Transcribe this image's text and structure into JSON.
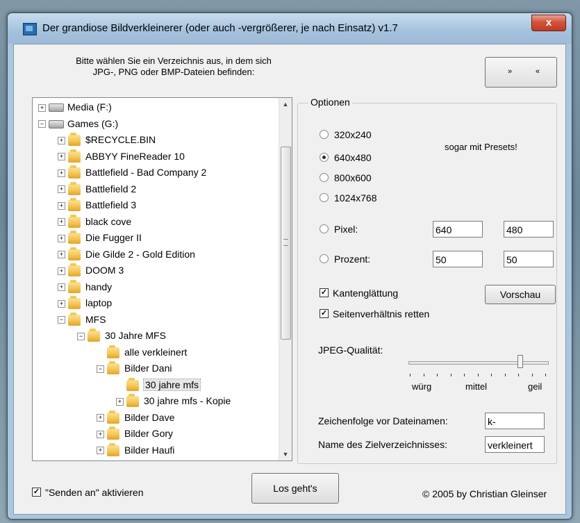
{
  "window": {
    "title": "Der grandiose Bildverkleinerer (oder auch -vergrößerer, je nach Einsatz) v1.7",
    "close_label": "x"
  },
  "intro": {
    "line1": "Bitte wählen Sie ein Verzeichnis aus, in dem sich",
    "line2": "JPG-, PNG oder BMP-Dateien befinden:"
  },
  "nav": {
    "forward": "»",
    "back": "«"
  },
  "tree": {
    "items": [
      {
        "label": "Media (F:)",
        "kind": "drive",
        "exp": "+"
      },
      {
        "label": "Games (G:)",
        "kind": "drive",
        "exp": "-"
      },
      {
        "label": "$RECYCLE.BIN",
        "kind": "folder",
        "exp": "+"
      },
      {
        "label": "ABBYY FineReader 10",
        "kind": "folder",
        "exp": "+"
      },
      {
        "label": "Battlefield - Bad Company 2",
        "kind": "folder",
        "exp": "+"
      },
      {
        "label": "Battlefield 2",
        "kind": "folder",
        "exp": "+"
      },
      {
        "label": "Battlefield 3",
        "kind": "folder",
        "exp": "+"
      },
      {
        "label": "black cove",
        "kind": "folder",
        "exp": "+"
      },
      {
        "label": "Die Fugger II",
        "kind": "folder",
        "exp": "+"
      },
      {
        "label": "Die Gilde 2 - Gold Edition",
        "kind": "folder",
        "exp": "+"
      },
      {
        "label": "DOOM 3",
        "kind": "folder",
        "exp": "+"
      },
      {
        "label": "handy",
        "kind": "folder",
        "exp": "+"
      },
      {
        "label": "laptop",
        "kind": "folder",
        "exp": "+"
      },
      {
        "label": "MFS",
        "kind": "folder",
        "exp": "-"
      },
      {
        "label": "30 Jahre MFS",
        "kind": "folder",
        "exp": "-"
      },
      {
        "label": "alle verkleinert",
        "kind": "folder",
        "exp": ""
      },
      {
        "label": "Bilder Dani",
        "kind": "folder",
        "exp": "-"
      },
      {
        "label": "30 jahre mfs",
        "kind": "folder",
        "exp": ""
      },
      {
        "label": "30 jahre mfs - Kopie",
        "kind": "folder",
        "exp": "+"
      },
      {
        "label": "Bilder Dave",
        "kind": "folder",
        "exp": "+"
      },
      {
        "label": "Bilder Gory",
        "kind": "folder",
        "exp": "+"
      },
      {
        "label": "Bilder Haufi",
        "kind": "folder",
        "exp": "+"
      }
    ]
  },
  "options": {
    "group_title": "Optionen",
    "presets_note": "sogar mit Presets!",
    "presets": [
      "320x240",
      "640x480",
      "800x600",
      "1024x768"
    ],
    "selected_preset": "640x480",
    "pixel_label": "Pixel:",
    "pixel_w": "640",
    "pixel_h": "480",
    "percent_label": "Prozent:",
    "percent_w": "50",
    "percent_h": "50",
    "antialias_label": "Kantenglättung",
    "antialias_checked": true,
    "aspect_label": "Seitenverhältnis retten",
    "aspect_checked": true,
    "preview_button": "Vorschau",
    "jpeg_label": "JPEG-Qualität:",
    "jpeg_quality": 0.8,
    "scale_low": "würg",
    "scale_mid": "mittel",
    "scale_high": "geil",
    "prefix_label": "Zeichenfolge vor Dateinamen:",
    "prefix_value": "k-",
    "target_label": "Name des Zielverzeichnisses:",
    "target_value": "verkleinert"
  },
  "footer": {
    "sendto_label": "\"Senden an\" aktivieren",
    "sendto_checked": true,
    "go_button": "Los geht's",
    "copyright": "© 2005 by Christian Gleinser"
  }
}
